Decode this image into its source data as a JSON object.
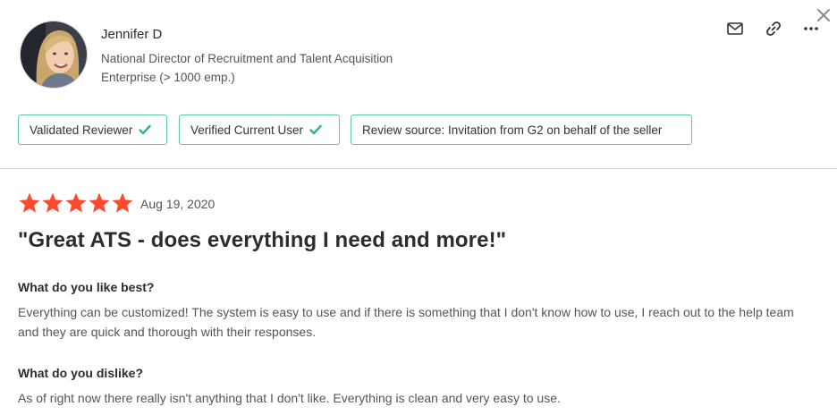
{
  "reviewer": {
    "name": "Jennifer D",
    "title": "National Director of Recruitment and Talent Acquisition",
    "company_size": "Enterprise (> 1000 emp.)"
  },
  "actions": {
    "icons": [
      "email-icon",
      "link-icon",
      "more-icon",
      "close-icon"
    ]
  },
  "badges": [
    {
      "label": "Validated Reviewer",
      "checked": true
    },
    {
      "label": "Verified Current User",
      "checked": true
    },
    {
      "label": "Review source: Invitation from G2 on behalf of the seller",
      "checked": false
    }
  ],
  "review": {
    "rating": 5,
    "date": "Aug 19, 2020",
    "title": "\"Great ATS - does everything I need and more!\"",
    "qa": [
      {
        "question": "What do you like best?",
        "answer": "Everything can be customized! The system is easy to use and if there is something that I don't know how to use, I reach out to the help team and they are quick and thorough with their responses."
      },
      {
        "question": "What do you dislike?",
        "answer": "As of right now there really isn't anything that I don't like. Everything is clean and very easy to use."
      }
    ]
  },
  "colors": {
    "star": "#ff492c",
    "badge_border": "#5fc9a6",
    "check": "#27b989"
  }
}
